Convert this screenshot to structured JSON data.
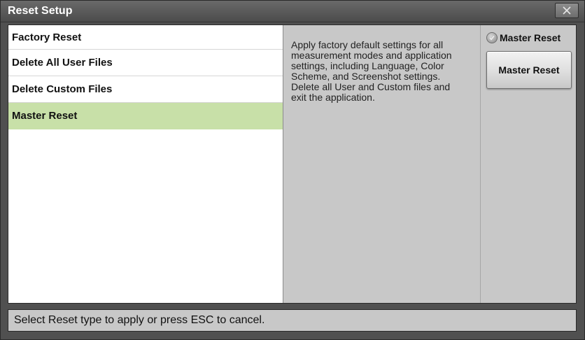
{
  "window": {
    "title": "Reset Setup",
    "close_icon": "close-icon"
  },
  "reset_list": {
    "items": [
      {
        "label": "Factory Reset",
        "selected": false
      },
      {
        "label": "Delete All User Files",
        "selected": false
      },
      {
        "label": "Delete Custom Files",
        "selected": false
      },
      {
        "label": "Master Reset",
        "selected": true
      }
    ]
  },
  "description": {
    "text": "Apply factory default settings for all measurement modes and application settings, including Language, Color Scheme, and Screenshot settings. Delete all User and Custom files and exit the application."
  },
  "right_panel": {
    "radio_label": "Master Reset",
    "button_label": "Master Reset"
  },
  "status_bar": {
    "text": "Select Reset type to apply or press ESC to cancel."
  },
  "colors": {
    "selected_row": "#c8e0a8",
    "panel_bg": "#c8c8c8",
    "title_bar": "#555555"
  }
}
